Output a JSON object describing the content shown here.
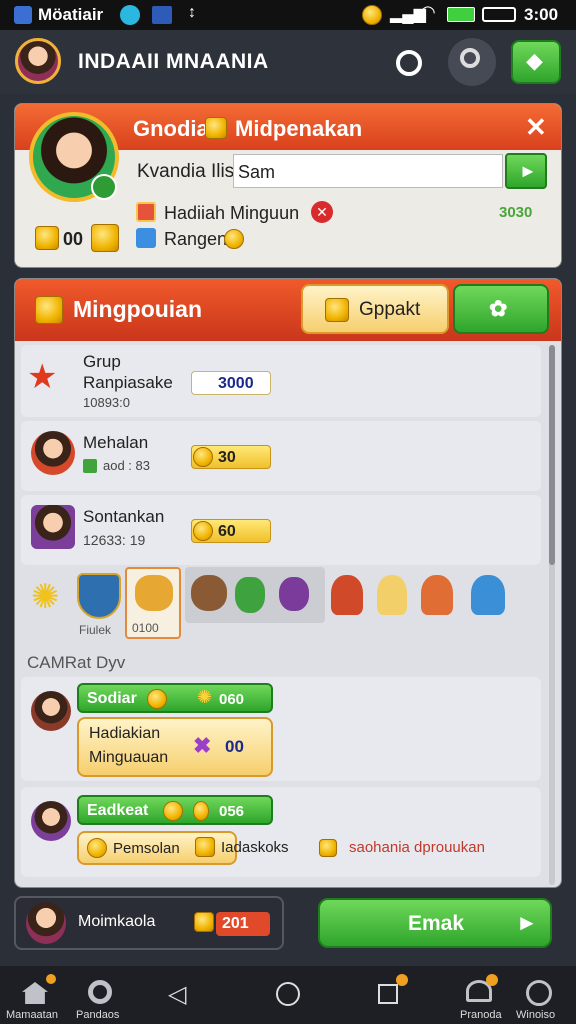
{
  "status": {
    "app_name": "Möatiair",
    "time": "3:00"
  },
  "header": {
    "title": "INDAAII MNAANIA"
  },
  "profile": {
    "title": "Gnodia",
    "title2": "Midpenakan",
    "field_label": "Kvandia Ilis",
    "field_value": "Sam",
    "reward_label": "Hadiiah Minguun",
    "reward_value": "3030",
    "ranger_label": "Rangen",
    "coin_count": "00"
  },
  "leaderboard": {
    "title": "Mingpouian",
    "gppakt_button": "Gppakt",
    "rows": [
      {
        "name": "Grup Ranpiasake",
        "sub": "10893:0",
        "score": "3000"
      },
      {
        "name": "Mehalan",
        "sub": "aod : 83",
        "score": "30"
      },
      {
        "name": "Sontankan",
        "sub": "12633: 19",
        "score": "60"
      }
    ],
    "collection_label": "Fiulek",
    "collection_price": "0100"
  },
  "section2": {
    "title": "CAMRat Dyv",
    "card1": {
      "tag": "Sodiar",
      "tag_score": "060",
      "text_line1": "Hadiakian",
      "text_line2": "Minguauan",
      "count": "00"
    },
    "card2": {
      "tag": "Eadkeat",
      "tag_score": "056",
      "chip1": "Pemsolan",
      "chip2": "Iadaskoks",
      "chip3": "saohania dprouukan"
    }
  },
  "footer_bar": {
    "name": "Moimkaola",
    "score": "201",
    "button": "Emak"
  },
  "nav": {
    "home": "Mamaatan",
    "item2": "Pandaos",
    "item3": "Pranoda",
    "item4": "Winoiso"
  }
}
